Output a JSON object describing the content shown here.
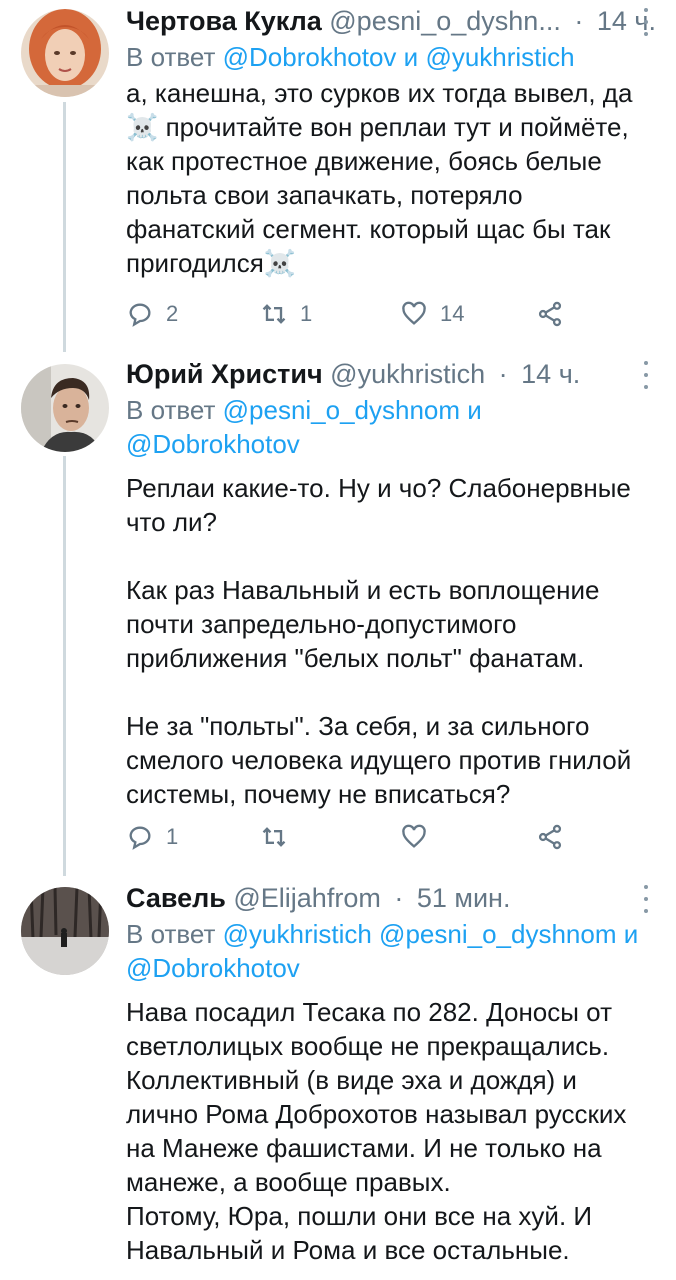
{
  "tweets": [
    {
      "name": "Чертова Кукла",
      "handle": "@pesni_o_dyshn...",
      "time": "14 ч.",
      "reply_prefix": "В ответ",
      "reply_mentions": [
        "@Dobrokhotov",
        "и",
        "@yukhristich"
      ],
      "body_lines": [
        "а, канешна, это сурков их тогда вывел, да",
        "☠️ прочитайте вон реплаи тут и поймёте,",
        "как протестное движение, боясь белые",
        "польта свои запачкать, потеряло",
        "фанатский сегмент. который щас бы так",
        "пригодился☠️"
      ],
      "reply_count": "2",
      "retweet_count": "1",
      "like_count": "14"
    },
    {
      "name": "Юрий Христич",
      "handle": "@yukhristich",
      "time": "14 ч.",
      "reply_prefix": "В ответ",
      "reply_line1": "@pesni_o_dyshnom и",
      "reply_line2": "@Dobrokhotov",
      "body": "Реплаи какие-то. Ну и чо? Слабонервные\nчто ли?\n\nКак раз Навальный и есть воплощение\nпочти запредельно-допустимого\nприближения \"белых польт\" фанатам.\n\nНе за \"польты\". За себя, и за сильного\nсмелого человека идущего против гнилой\nсистемы, почему не вписаться?",
      "reply_count": "1",
      "retweet_count": "",
      "like_count": ""
    },
    {
      "name": "Савель",
      "handle": "@Elijahfrom",
      "time": "51 мин.",
      "reply_prefix": "В ответ",
      "reply_line1": "@yukhristich @pesni_o_dyshnom и",
      "reply_line2": "@Dobrokhotov",
      "body": "Нава посадил Тесака по 282. Доносы от\nсветлолицых вообще не прекращались.\nКоллективный (в виде эха и дождя) и\nлично Рома Доброхотов называл русских\nна Манеже фашистами. И не только на\nманеже, а вообще правых.\nПотому, Юра, пошли они все на хуй. И\nНавальный и Рома и все остальные."
    }
  ],
  "colors": {
    "link": "#1da1f2",
    "secondary_text": "#657786",
    "thread_line": "#cfd9de"
  },
  "icons": [
    "reply-icon",
    "retweet-icon",
    "like-icon",
    "share-icon",
    "more-icon"
  ]
}
